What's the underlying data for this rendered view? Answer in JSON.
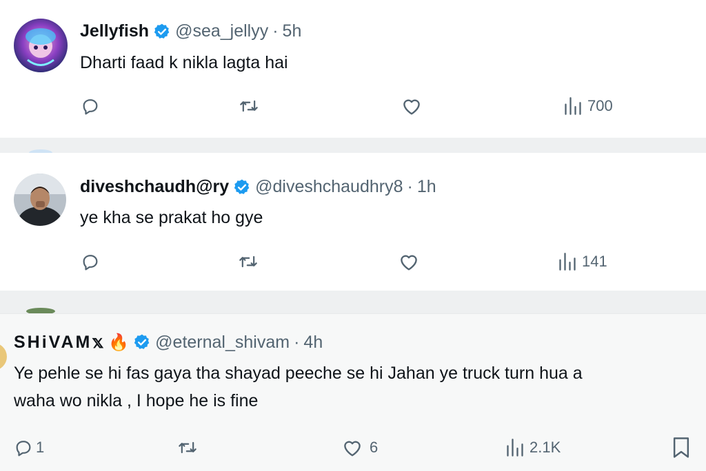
{
  "tweets": [
    {
      "display_name": "Jellyfish",
      "handle": "@sea_jellyy",
      "separator": "·",
      "time": "5h",
      "text": "Dharti faad k nikla lagta hai",
      "actions": {
        "reply": "",
        "retweet": "",
        "like": "",
        "views": "700"
      }
    },
    {
      "display_name": "diveshchaudh@ry",
      "handle": "@diveshchaudhry8",
      "separator": "·",
      "time": "1h",
      "text": "ye kha se prakat ho gye",
      "actions": {
        "reply": "",
        "retweet": "",
        "like": "",
        "views": "141"
      }
    },
    {
      "display_name": "SHiVAM𝕩",
      "display_name_emoji": "🔥",
      "handle": "@eternal_shivam",
      "separator": "·",
      "time": "4h",
      "text_line1": "Ye pehle se hi fas gaya tha shayad peeche se hi Jahan ye truck turn hua a",
      "text_line2": "waha wo nikla , I hope he is fine",
      "actions": {
        "reply": "1",
        "retweet": "",
        "like": "6",
        "views": "2.1K"
      }
    }
  ],
  "icons": {
    "reply": "reply-icon",
    "retweet": "retweet-icon",
    "like": "heart-icon",
    "views": "views-icon",
    "bookmark": "bookmark-icon",
    "verified": "verified-badge-icon"
  },
  "colors": {
    "verified_blue": "#1d9bf0",
    "text_primary": "#0f1419",
    "text_secondary": "#536471"
  }
}
